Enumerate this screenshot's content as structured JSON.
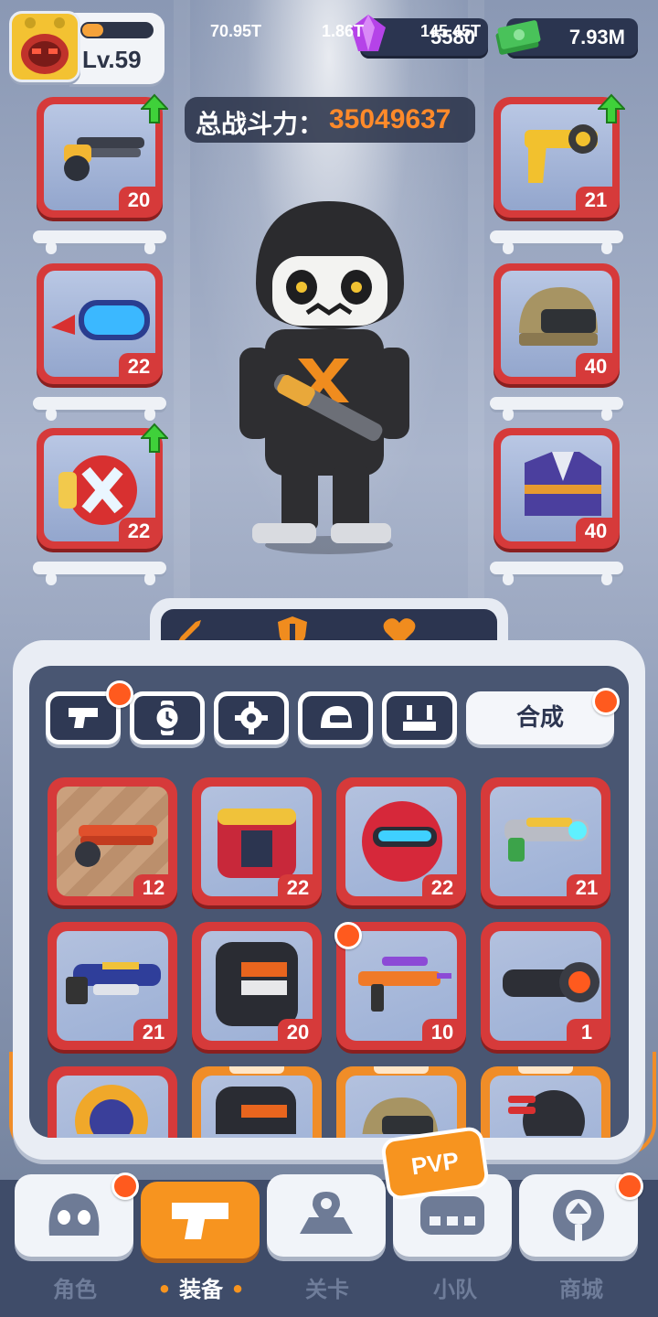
{
  "player": {
    "level": "Lv.59",
    "xp_fraction": 0.3
  },
  "currency": {
    "gems": "5580",
    "cash": "7.93M"
  },
  "power": {
    "label": "总战斗力：",
    "value": "35049637"
  },
  "equipped": {
    "left": [
      {
        "level": "20",
        "upgrade": true
      },
      {
        "level": "22",
        "upgrade": false
      },
      {
        "level": "22",
        "upgrade": true
      }
    ],
    "right": [
      {
        "level": "21",
        "upgrade": true
      },
      {
        "level": "40",
        "upgrade": false
      },
      {
        "level": "40",
        "upgrade": false
      }
    ]
  },
  "stats": {
    "attack": "70.95T",
    "defense": "1.86T",
    "health": "145.45T"
  },
  "tabs": {
    "merge_label": "合成"
  },
  "inventory": [
    {
      "level": "12"
    },
    {
      "level": "22"
    },
    {
      "level": "22"
    },
    {
      "level": "21"
    },
    {
      "level": "21"
    },
    {
      "level": "20"
    },
    {
      "level": "10"
    },
    {
      "level": "1"
    }
  ],
  "nav": {
    "pvp_label": "PVP",
    "items": [
      "角色",
      "装备",
      "关卡",
      "小队",
      "商城"
    ],
    "active_index": 1
  },
  "colors": {
    "accent": "#f7941f",
    "slot_red": "#d63a3a",
    "dark_panel": "#2c3550",
    "power_orange": "#ff8a2a"
  }
}
